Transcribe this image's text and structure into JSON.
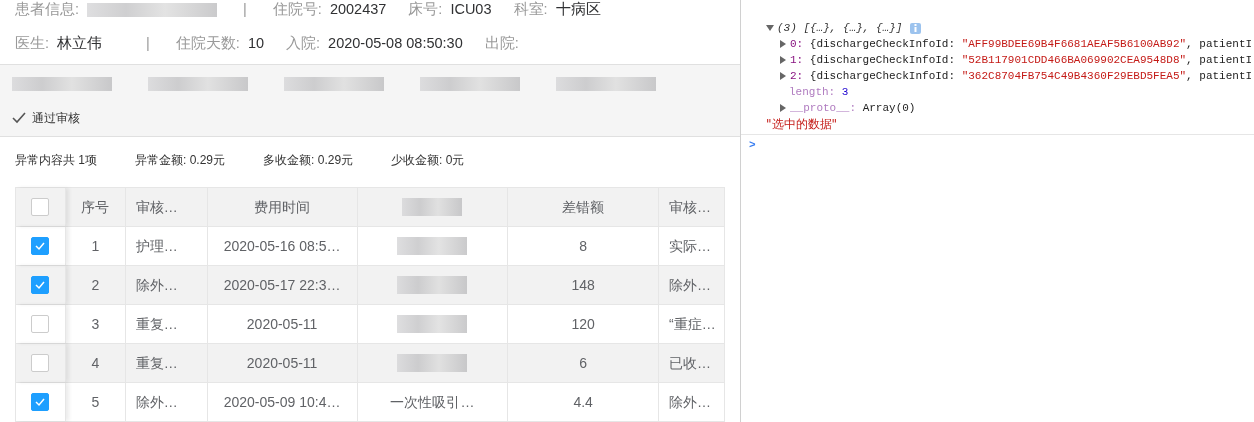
{
  "patient_info": [
    {
      "kind": "field",
      "label": "患者信息:",
      "redacted": true
    },
    {
      "kind": "separator",
      "text": "|"
    },
    {
      "kind": "field",
      "label": "住院号:",
      "value": "2002437"
    },
    {
      "kind": "field",
      "label": "床号:",
      "value": "ICU03"
    },
    {
      "kind": "field",
      "label": "科室:",
      "value": "十病区"
    },
    {
      "kind": "field",
      "label": "医生:",
      "value": "林立伟"
    },
    {
      "kind": "separator",
      "text": "|"
    },
    {
      "kind": "field",
      "label": "住院天数:",
      "value": "10"
    },
    {
      "kind": "field",
      "label": "入院:",
      "value": "2020-05-08 08:50:30"
    },
    {
      "kind": "field",
      "label": "出院:"
    }
  ],
  "toolbar": {
    "approve_button": "通过审核"
  },
  "summary": [
    "异常内容共 1项",
    "异常金额: 0.29元",
    "多收金额: 0.29元",
    "少收金额: 0元"
  ],
  "table": {
    "header_checked": false,
    "columns": [
      "序号",
      "审核…",
      "费用时间",
      "",
      "差错额",
      "审核…"
    ],
    "rows": [
      {
        "checked": true,
        "cells": [
          "1",
          "护理…",
          "2020-05-16 08:5…",
          "",
          "8",
          "实际…"
        ]
      },
      {
        "checked": true,
        "cells": [
          "2",
          "除外…",
          "2020-05-17 22:3…",
          "",
          "148",
          "除外…"
        ]
      },
      {
        "checked": false,
        "cells": [
          "3",
          "重复…",
          "2020-05-11",
          "",
          "120",
          "“重症…"
        ]
      },
      {
        "checked": false,
        "cells": [
          "4",
          "重复…",
          "2020-05-11",
          "",
          "6",
          "已收…"
        ]
      },
      {
        "checked": true,
        "cells": [
          "5",
          "除外…",
          "2020-05-09 10:4…",
          "一次性吸引…",
          "4.4",
          "除外…"
        ]
      }
    ]
  },
  "console": [
    {
      "kind": "array",
      "expanded": true,
      "text": "(3) [{…}, {…}, {…}]"
    },
    {
      "kind": "entry",
      "expanded": false,
      "key": "0:",
      "open": "{dischargeCheckInfoId:",
      "value": "\"AFF99BDEE69B4F6681AEAF5B6100AB92\"",
      "rest": ", patientI"
    },
    {
      "kind": "entry",
      "expanded": false,
      "key": "1:",
      "open": "{dischargeCheckInfoId:",
      "value": "\"52B117901CDD466BA069902CEA9548D8\"",
      "rest": ", patientI"
    },
    {
      "kind": "entry",
      "expanded": false,
      "key": "2:",
      "open": "{dischargeCheckInfoId:",
      "value": "\"362C8704FB754C49B4360F29EBD5FEA5\"",
      "rest": ", patientI"
    },
    {
      "kind": "length",
      "key": "length:",
      "value": "3"
    },
    {
      "kind": "proto",
      "expanded": false,
      "key": "__proto__:",
      "value": "Array(0)"
    },
    {
      "kind": "log",
      "text": "\"选中的数据\""
    },
    {
      "kind": "prompt",
      "text": ">"
    }
  ]
}
